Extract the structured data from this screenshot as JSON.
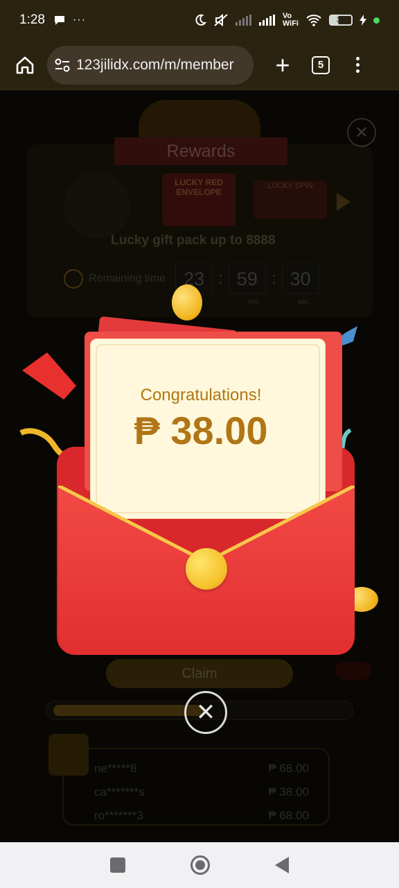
{
  "status_bar": {
    "time": "1:28",
    "overflow": "···",
    "network_label_top": "Vo",
    "network_label_bottom": "WiFi",
    "battery": "39"
  },
  "browser": {
    "url": "123jilidx.com/m/member",
    "tab_count": "5"
  },
  "background_page": {
    "title": "Rewards",
    "card1_label": "LUCKY RED ENVELOPE",
    "card2_label": "LUCKY SPIN",
    "lucky_text": "Lucky gift pack up to 8888",
    "remaining_label": "Remaining time",
    "timer": {
      "hours": "23",
      "minutes": "59",
      "seconds": "30"
    },
    "timer_units": {
      "min": "min",
      "sec": "sec"
    },
    "claim_label": "Claim",
    "winners": [
      {
        "name": "ne*****8",
        "amount": "₱ 68.00"
      },
      {
        "name": "ca*******s",
        "amount": "₱ 38.00"
      },
      {
        "name": "ro*******3",
        "amount": "₱ 68.00"
      }
    ]
  },
  "popup": {
    "congrats": "Congratulations!",
    "amount": "₱ 38.00"
  },
  "colors": {
    "envelope_red": "#e8302f",
    "gold_text": "#b07616",
    "letter_bg": "#fff8dc"
  }
}
